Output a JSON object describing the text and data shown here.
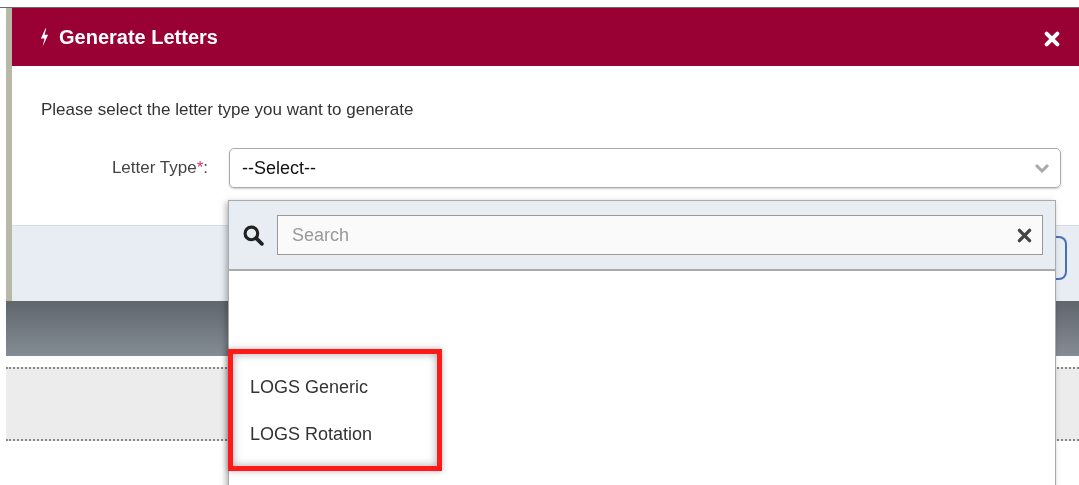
{
  "dialog": {
    "title": "Generate Letters",
    "prompt": "Please select the letter type you want to generate",
    "field": {
      "label": "Letter Type",
      "required": true,
      "required_mark": "*",
      "separator": ":",
      "value": "--Select--"
    }
  },
  "dropdown": {
    "search": {
      "placeholder": "Search"
    },
    "options": [
      {
        "label": "LOGS Generic",
        "highlighted": true
      },
      {
        "label": "LOGS Rotation",
        "highlighted": true
      }
    ]
  }
}
